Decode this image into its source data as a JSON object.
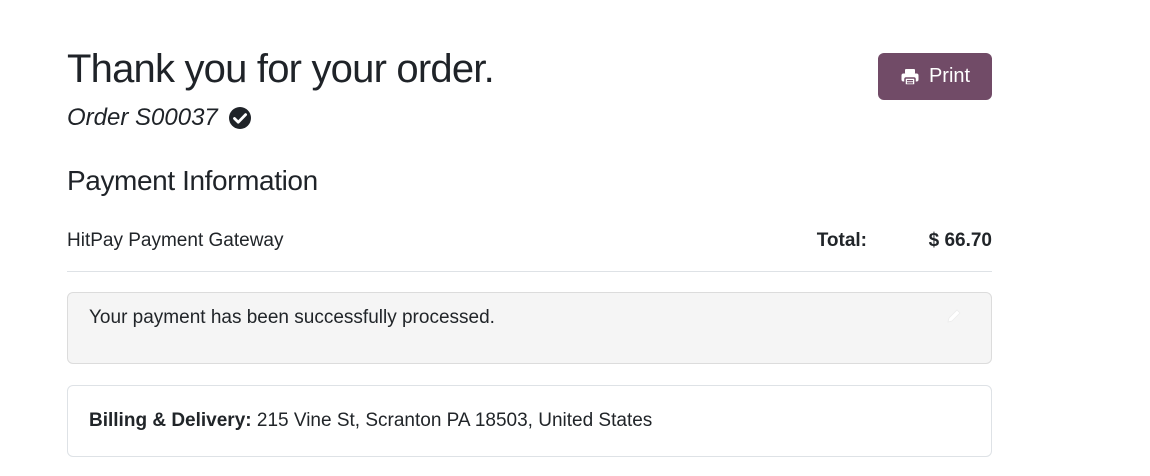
{
  "header": {
    "title": "Thank you for your order.",
    "order_label": "Order S00037",
    "order_status_icon": "check-circle-icon",
    "print_label": "Print",
    "print_icon": "printer-icon"
  },
  "payment": {
    "section_title": "Payment Information",
    "provider": "HitPay Payment Gateway",
    "total_label": "Total:",
    "total_value": "$ 66.70",
    "status_message": "Your payment has been successfully processed."
  },
  "billing": {
    "label": "Billing & Delivery:",
    "address": " 215 Vine St, Scranton PA 18503, United States"
  },
  "colors": {
    "primary": "#714b67",
    "text": "#212529",
    "alert_background": "#f5f5f5"
  }
}
